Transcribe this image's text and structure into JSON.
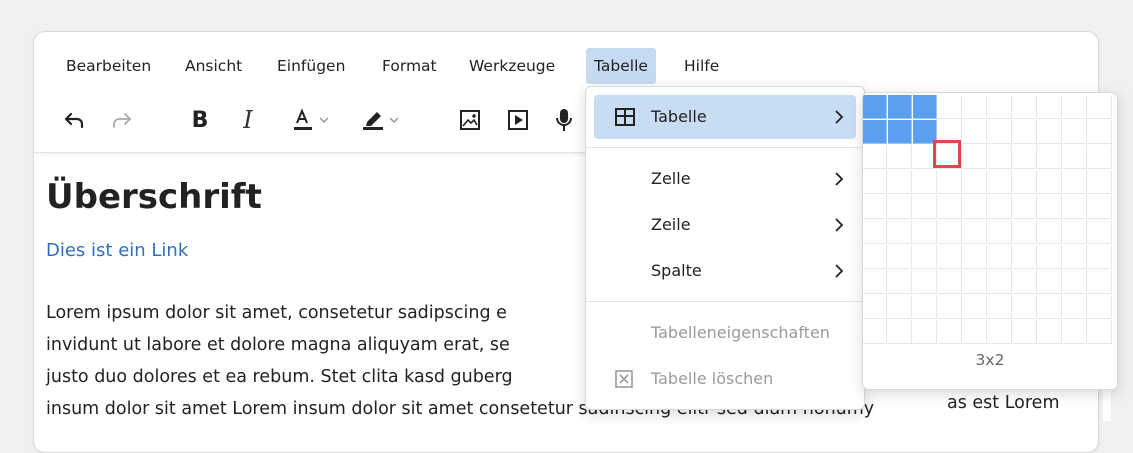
{
  "menubar": {
    "items": [
      {
        "label": "Bearbeiten"
      },
      {
        "label": "Ansicht"
      },
      {
        "label": "Einfügen"
      },
      {
        "label": "Format"
      },
      {
        "label": "Werkzeuge"
      },
      {
        "label": "Tabelle",
        "active": true
      },
      {
        "label": "Hilfe"
      }
    ]
  },
  "toolbar": {
    "buttons": [
      "undo-icon",
      "redo-icon",
      "bold-icon",
      "italic-icon",
      "text-color-icon",
      "highlight-color-icon",
      "image-icon",
      "media-icon",
      "microphone-icon"
    ],
    "bold_glyph": "B",
    "italic_glyph": "I",
    "textcolor_glyph": "A",
    "accent_red": "#e0484e"
  },
  "content": {
    "heading": "Überschrift",
    "link": "Dies ist ein Link",
    "paragraph_lines": [
      "Lorem ipsum dolor sit amet, consetetur sadipscing e",
      "invidunt ut labore et dolore magna aliquyam erat, se",
      "justo duo dolores et ea rebum. Stet clita kasd guberg",
      "insum dolor sit amet Lorem insum dolor sit amet consetetur sadinscing elitr sed diam nonumy"
    ],
    "right_overflow": "as est Lorem"
  },
  "menu": {
    "items": [
      {
        "label": "Tabelle",
        "icon": "table-icon",
        "submenu": true,
        "highlighted": true
      },
      {
        "label": "Zelle",
        "submenu": true
      },
      {
        "label": "Zeile",
        "submenu": true
      },
      {
        "label": "Spalte",
        "submenu": true
      },
      {
        "label": "Tabelleneigenschaften",
        "disabled": true
      },
      {
        "label": "Tabelle löschen",
        "icon": "delete-table-icon",
        "disabled": true
      }
    ]
  },
  "grid": {
    "columns": 10,
    "rows": 10,
    "selected_cols": 3,
    "selected_rows": 2,
    "label": "3x2",
    "selection_color": "#5aa0ef"
  }
}
